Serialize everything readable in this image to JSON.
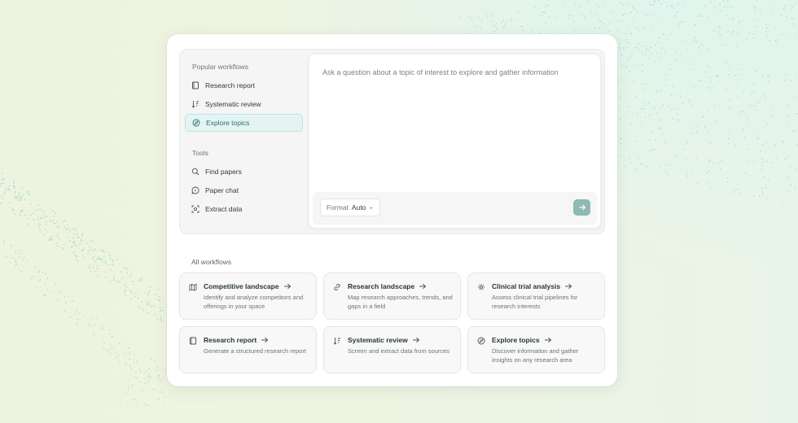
{
  "sidebar": {
    "popular_title": "Popular workflows",
    "popular_items": [
      {
        "label": "Research report",
        "icon": "book-icon"
      },
      {
        "label": "Systematic review",
        "icon": "sort-icon"
      },
      {
        "label": "Explore topics",
        "icon": "compass-icon",
        "active": true
      }
    ],
    "tools_title": "Tools",
    "tool_items": [
      {
        "label": "Find papers",
        "icon": "search-icon"
      },
      {
        "label": "Paper chat",
        "icon": "chat-icon"
      },
      {
        "label": "Extract data",
        "icon": "extract-icon"
      }
    ]
  },
  "editor": {
    "placeholder": "Ask a question about a topic of interest to explore and gather information",
    "format_label": "Format",
    "format_value": "Auto",
    "send_icon": "arrow-right-icon"
  },
  "workflows": {
    "title": "All workflows",
    "cards": [
      {
        "title": "Competitive landscape",
        "desc": "Identify and analyze competitors and offerings in your space",
        "icon": "map-icon"
      },
      {
        "title": "Research landscape",
        "desc": "Map research approaches, trends, and gaps in a field",
        "icon": "link-icon"
      },
      {
        "title": "Clinical trial analysis",
        "desc": "Assess clinical trial pipelines for research interests",
        "icon": "gear-icon"
      },
      {
        "title": "Research report",
        "desc": "Generate a structured research report",
        "icon": "book-icon"
      },
      {
        "title": "Systematic review",
        "desc": "Screen and extract data from sources",
        "icon": "sort-icon"
      },
      {
        "title": "Explore topics",
        "desc": "Discover information and gather insights on any research area",
        "icon": "compass-icon"
      }
    ]
  },
  "colors": {
    "accent": "#8fb8b6",
    "active_bg": "#e3f4f3"
  }
}
